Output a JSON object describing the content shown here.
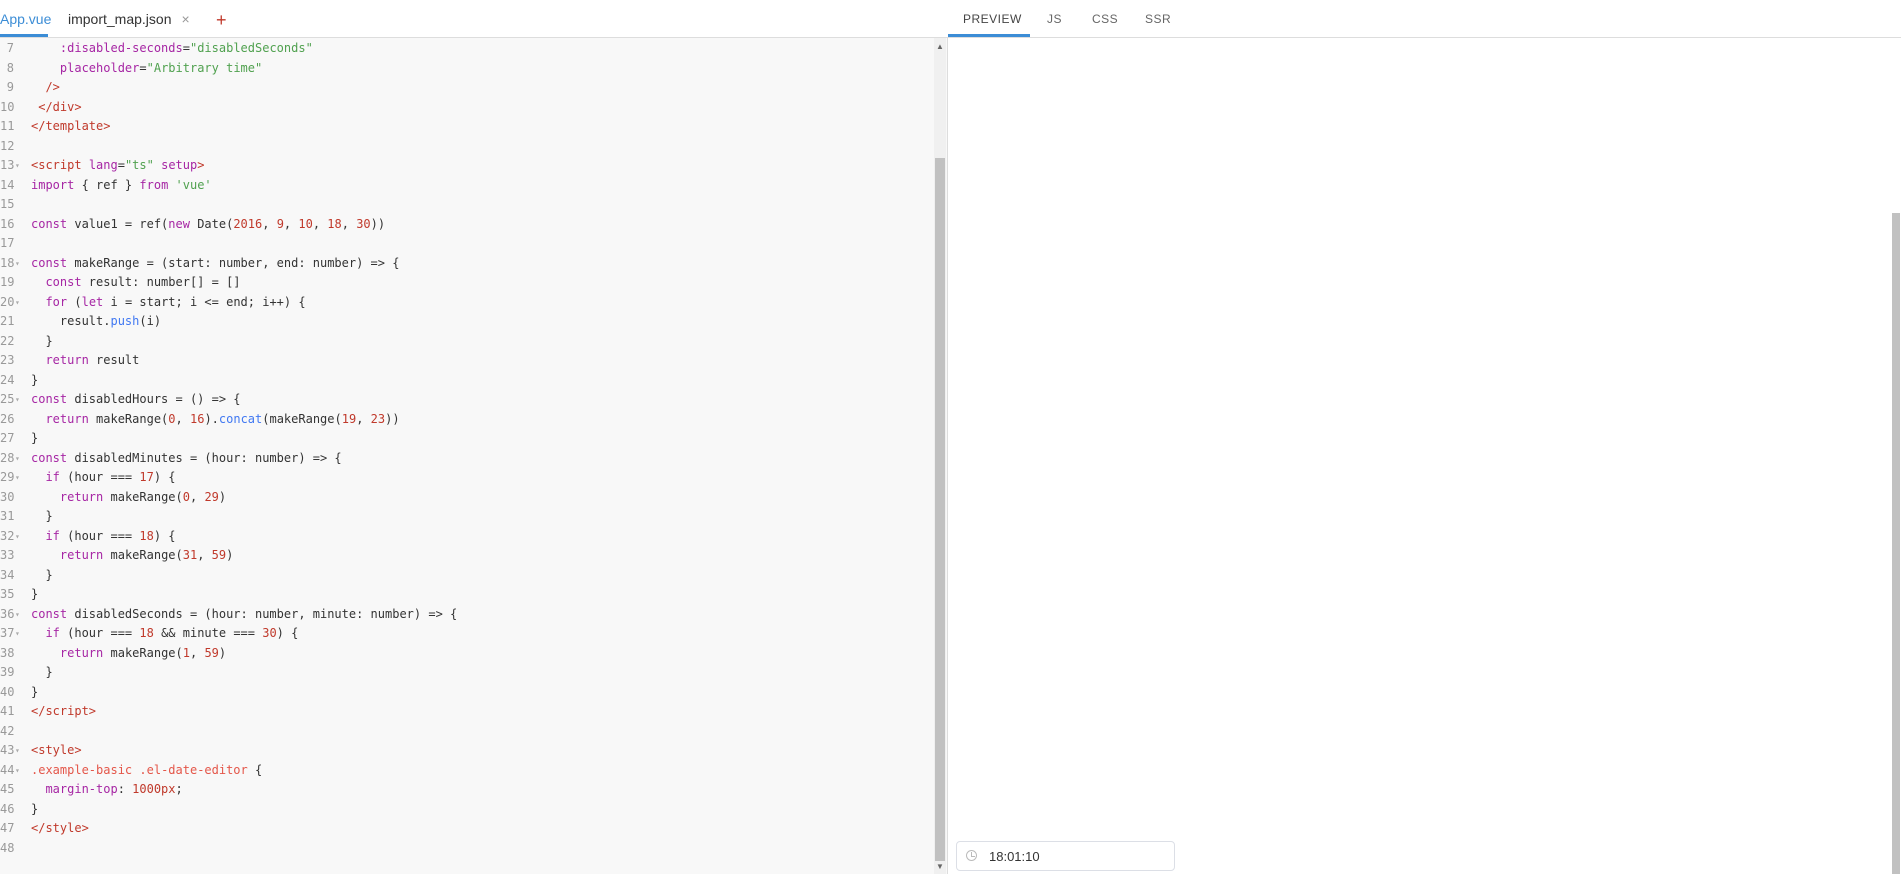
{
  "editor": {
    "tabs": [
      {
        "label": "App.vue"
      },
      {
        "label": "import_map.json",
        "close": "×"
      }
    ],
    "add_tab": "+",
    "lines": [
      {
        "n": "7",
        "html": "    <span class=\"a\">:disabled-seconds</span>=<span class=\"s\">\"disabledSeconds\"</span>"
      },
      {
        "n": "8",
        "html": "    <span class=\"a\">placeholder</span>=<span class=\"s\">\"Arbitrary time\"</span>"
      },
      {
        "n": "9",
        "html": "  <span class=\"t\">/&gt;</span>"
      },
      {
        "n": "10",
        "html": " <span class=\"t\">&lt;/div&gt;</span>"
      },
      {
        "n": "11",
        "html": "<span class=\"t\">&lt;/template&gt;</span>"
      },
      {
        "n": "12",
        "html": ""
      },
      {
        "n": "13",
        "fold": true,
        "html": "<span class=\"t\">&lt;script</span> <span class=\"a\">lang</span>=<span class=\"s\">\"ts\"</span> <span class=\"a\">setup</span><span class=\"t\">&gt;</span>"
      },
      {
        "n": "14",
        "html": "<span class=\"k\">import</span> { ref } <span class=\"k\">from</span> <span class=\"s\">'vue'</span>"
      },
      {
        "n": "15",
        "html": ""
      },
      {
        "n": "16",
        "html": "<span class=\"k\">const</span> value1 = ref(<span class=\"k\">new</span> Date(<span class=\"n\">2016</span>, <span class=\"n\">9</span>, <span class=\"n\">10</span>, <span class=\"n\">18</span>, <span class=\"n\">30</span>))"
      },
      {
        "n": "17",
        "html": ""
      },
      {
        "n": "18",
        "fold": true,
        "html": "<span class=\"k\">const</span> makeRange = (start: number, end: number) =&gt; {"
      },
      {
        "n": "19",
        "html": "  <span class=\"k\">const</span> result: number[] = []"
      },
      {
        "n": "20",
        "fold": true,
        "html": "  <span class=\"k\">for</span> (<span class=\"k\">let</span> i = start; i &lt;= end; i++) {"
      },
      {
        "n": "21",
        "html": "    result.<span class=\"f\">push</span>(i)"
      },
      {
        "n": "22",
        "html": "  }"
      },
      {
        "n": "23",
        "html": "  <span class=\"k\">return</span> result"
      },
      {
        "n": "24",
        "html": "}"
      },
      {
        "n": "25",
        "fold": true,
        "html": "<span class=\"k\">const</span> disabledHours = () =&gt; {"
      },
      {
        "n": "26",
        "html": "  <span class=\"k\">return</span> makeRange(<span class=\"n\">0</span>, <span class=\"n\">16</span>).<span class=\"f\">concat</span>(makeRange(<span class=\"n\">19</span>, <span class=\"n\">23</span>))"
      },
      {
        "n": "27",
        "html": "}"
      },
      {
        "n": "28",
        "fold": true,
        "html": "<span class=\"k\">const</span> disabledMinutes = (hour: number) =&gt; {"
      },
      {
        "n": "29",
        "fold": true,
        "html": "  <span class=\"k\">if</span> (hour === <span class=\"n\">17</span>) {"
      },
      {
        "n": "30",
        "html": "    <span class=\"k\">return</span> makeRange(<span class=\"n\">0</span>, <span class=\"n\">29</span>)"
      },
      {
        "n": "31",
        "html": "  }"
      },
      {
        "n": "32",
        "fold": true,
        "html": "  <span class=\"k\">if</span> (hour === <span class=\"n\">18</span>) {"
      },
      {
        "n": "33",
        "html": "    <span class=\"k\">return</span> makeRange(<span class=\"n\">31</span>, <span class=\"n\">59</span>)"
      },
      {
        "n": "34",
        "html": "  }"
      },
      {
        "n": "35",
        "html": "}"
      },
      {
        "n": "36",
        "fold": true,
        "html": "<span class=\"k\">const</span> disabledSeconds = (hour: number, minute: number) =&gt; {"
      },
      {
        "n": "37",
        "fold": true,
        "html": "  <span class=\"k\">if</span> (hour === <span class=\"n\">18</span> &amp;&amp; minute === <span class=\"n\">30</span>) {"
      },
      {
        "n": "38",
        "html": "    <span class=\"k\">return</span> makeRange(<span class=\"n\">1</span>, <span class=\"n\">59</span>)"
      },
      {
        "n": "39",
        "html": "  }"
      },
      {
        "n": "40",
        "html": "}"
      },
      {
        "n": "41",
        "html": "<span class=\"t\">&lt;/script&gt;</span>"
      },
      {
        "n": "42",
        "html": ""
      },
      {
        "n": "43",
        "fold": true,
        "html": "<span class=\"t\">&lt;style&gt;</span>"
      },
      {
        "n": "44",
        "fold": true,
        "html": "<span class=\"p\">.example-basic</span> <span class=\"p\">.el-date-editor</span> {"
      },
      {
        "n": "45",
        "html": "  <span class=\"a\">margin-top</span>: <span class=\"n\">1000px</span>;"
      },
      {
        "n": "46",
        "html": "}"
      },
      {
        "n": "47",
        "html": "<span class=\"t\">&lt;/style&gt;</span>"
      },
      {
        "n": "48",
        "html": ""
      }
    ]
  },
  "preview": {
    "tabs": [
      {
        "label": "PREVIEW"
      },
      {
        "label": "JS"
      },
      {
        "label": "CSS"
      },
      {
        "label": "SSR"
      }
    ],
    "time_value": "18:01:10"
  }
}
